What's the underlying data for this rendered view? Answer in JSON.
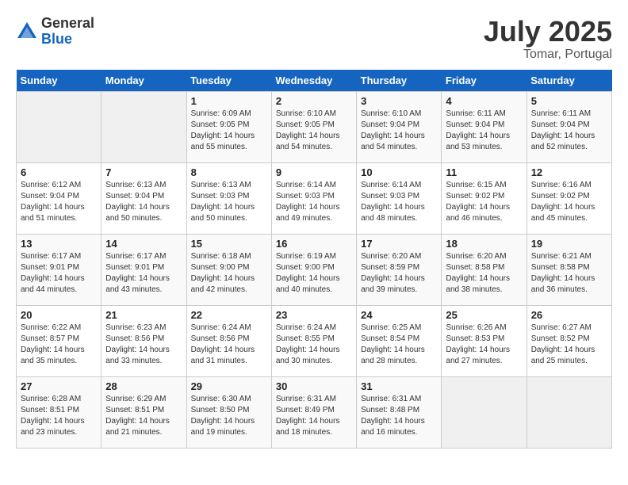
{
  "header": {
    "logo_general": "General",
    "logo_blue": "Blue",
    "month": "July 2025",
    "location": "Tomar, Portugal"
  },
  "weekdays": [
    "Sunday",
    "Monday",
    "Tuesday",
    "Wednesday",
    "Thursday",
    "Friday",
    "Saturday"
  ],
  "weeks": [
    [
      {
        "day": "",
        "sunrise": "",
        "sunset": "",
        "daylight": ""
      },
      {
        "day": "",
        "sunrise": "",
        "sunset": "",
        "daylight": ""
      },
      {
        "day": "1",
        "sunrise": "Sunrise: 6:09 AM",
        "sunset": "Sunset: 9:05 PM",
        "daylight": "Daylight: 14 hours and 55 minutes."
      },
      {
        "day": "2",
        "sunrise": "Sunrise: 6:10 AM",
        "sunset": "Sunset: 9:05 PM",
        "daylight": "Daylight: 14 hours and 54 minutes."
      },
      {
        "day": "3",
        "sunrise": "Sunrise: 6:10 AM",
        "sunset": "Sunset: 9:04 PM",
        "daylight": "Daylight: 14 hours and 54 minutes."
      },
      {
        "day": "4",
        "sunrise": "Sunrise: 6:11 AM",
        "sunset": "Sunset: 9:04 PM",
        "daylight": "Daylight: 14 hours and 53 minutes."
      },
      {
        "day": "5",
        "sunrise": "Sunrise: 6:11 AM",
        "sunset": "Sunset: 9:04 PM",
        "daylight": "Daylight: 14 hours and 52 minutes."
      }
    ],
    [
      {
        "day": "6",
        "sunrise": "Sunrise: 6:12 AM",
        "sunset": "Sunset: 9:04 PM",
        "daylight": "Daylight: 14 hours and 51 minutes."
      },
      {
        "day": "7",
        "sunrise": "Sunrise: 6:13 AM",
        "sunset": "Sunset: 9:04 PM",
        "daylight": "Daylight: 14 hours and 50 minutes."
      },
      {
        "day": "8",
        "sunrise": "Sunrise: 6:13 AM",
        "sunset": "Sunset: 9:03 PM",
        "daylight": "Daylight: 14 hours and 50 minutes."
      },
      {
        "day": "9",
        "sunrise": "Sunrise: 6:14 AM",
        "sunset": "Sunset: 9:03 PM",
        "daylight": "Daylight: 14 hours and 49 minutes."
      },
      {
        "day": "10",
        "sunrise": "Sunrise: 6:14 AM",
        "sunset": "Sunset: 9:03 PM",
        "daylight": "Daylight: 14 hours and 48 minutes."
      },
      {
        "day": "11",
        "sunrise": "Sunrise: 6:15 AM",
        "sunset": "Sunset: 9:02 PM",
        "daylight": "Daylight: 14 hours and 46 minutes."
      },
      {
        "day": "12",
        "sunrise": "Sunrise: 6:16 AM",
        "sunset": "Sunset: 9:02 PM",
        "daylight": "Daylight: 14 hours and 45 minutes."
      }
    ],
    [
      {
        "day": "13",
        "sunrise": "Sunrise: 6:17 AM",
        "sunset": "Sunset: 9:01 PM",
        "daylight": "Daylight: 14 hours and 44 minutes."
      },
      {
        "day": "14",
        "sunrise": "Sunrise: 6:17 AM",
        "sunset": "Sunset: 9:01 PM",
        "daylight": "Daylight: 14 hours and 43 minutes."
      },
      {
        "day": "15",
        "sunrise": "Sunrise: 6:18 AM",
        "sunset": "Sunset: 9:00 PM",
        "daylight": "Daylight: 14 hours and 42 minutes."
      },
      {
        "day": "16",
        "sunrise": "Sunrise: 6:19 AM",
        "sunset": "Sunset: 9:00 PM",
        "daylight": "Daylight: 14 hours and 40 minutes."
      },
      {
        "day": "17",
        "sunrise": "Sunrise: 6:20 AM",
        "sunset": "Sunset: 8:59 PM",
        "daylight": "Daylight: 14 hours and 39 minutes."
      },
      {
        "day": "18",
        "sunrise": "Sunrise: 6:20 AM",
        "sunset": "Sunset: 8:58 PM",
        "daylight": "Daylight: 14 hours and 38 minutes."
      },
      {
        "day": "19",
        "sunrise": "Sunrise: 6:21 AM",
        "sunset": "Sunset: 8:58 PM",
        "daylight": "Daylight: 14 hours and 36 minutes."
      }
    ],
    [
      {
        "day": "20",
        "sunrise": "Sunrise: 6:22 AM",
        "sunset": "Sunset: 8:57 PM",
        "daylight": "Daylight: 14 hours and 35 minutes."
      },
      {
        "day": "21",
        "sunrise": "Sunrise: 6:23 AM",
        "sunset": "Sunset: 8:56 PM",
        "daylight": "Daylight: 14 hours and 33 minutes."
      },
      {
        "day": "22",
        "sunrise": "Sunrise: 6:24 AM",
        "sunset": "Sunset: 8:56 PM",
        "daylight": "Daylight: 14 hours and 31 minutes."
      },
      {
        "day": "23",
        "sunrise": "Sunrise: 6:24 AM",
        "sunset": "Sunset: 8:55 PM",
        "daylight": "Daylight: 14 hours and 30 minutes."
      },
      {
        "day": "24",
        "sunrise": "Sunrise: 6:25 AM",
        "sunset": "Sunset: 8:54 PM",
        "daylight": "Daylight: 14 hours and 28 minutes."
      },
      {
        "day": "25",
        "sunrise": "Sunrise: 6:26 AM",
        "sunset": "Sunset: 8:53 PM",
        "daylight": "Daylight: 14 hours and 27 minutes."
      },
      {
        "day": "26",
        "sunrise": "Sunrise: 6:27 AM",
        "sunset": "Sunset: 8:52 PM",
        "daylight": "Daylight: 14 hours and 25 minutes."
      }
    ],
    [
      {
        "day": "27",
        "sunrise": "Sunrise: 6:28 AM",
        "sunset": "Sunset: 8:51 PM",
        "daylight": "Daylight: 14 hours and 23 minutes."
      },
      {
        "day": "28",
        "sunrise": "Sunrise: 6:29 AM",
        "sunset": "Sunset: 8:51 PM",
        "daylight": "Daylight: 14 hours and 21 minutes."
      },
      {
        "day": "29",
        "sunrise": "Sunrise: 6:30 AM",
        "sunset": "Sunset: 8:50 PM",
        "daylight": "Daylight: 14 hours and 19 minutes."
      },
      {
        "day": "30",
        "sunrise": "Sunrise: 6:31 AM",
        "sunset": "Sunset: 8:49 PM",
        "daylight": "Daylight: 14 hours and 18 minutes."
      },
      {
        "day": "31",
        "sunrise": "Sunrise: 6:31 AM",
        "sunset": "Sunset: 8:48 PM",
        "daylight": "Daylight: 14 hours and 16 minutes."
      },
      {
        "day": "",
        "sunrise": "",
        "sunset": "",
        "daylight": ""
      },
      {
        "day": "",
        "sunrise": "",
        "sunset": "",
        "daylight": ""
      }
    ]
  ]
}
